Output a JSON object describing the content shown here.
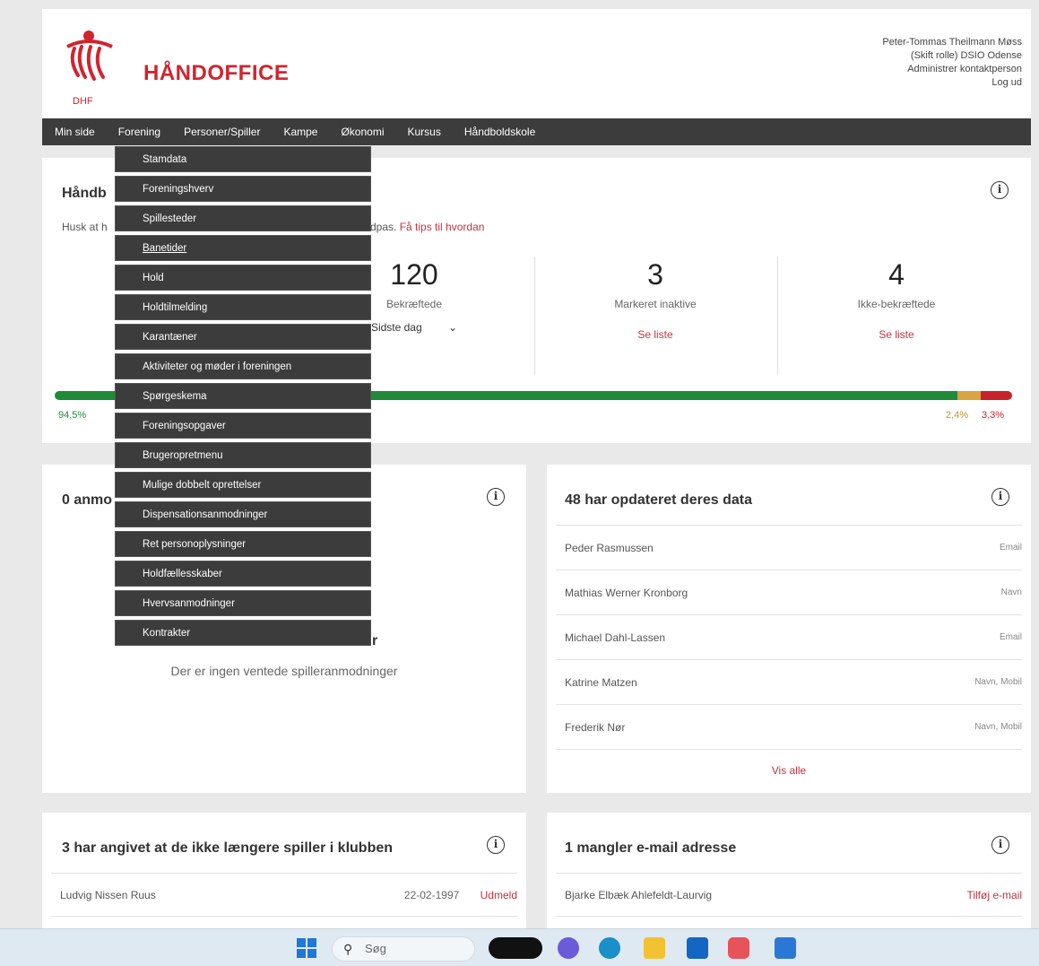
{
  "header": {
    "brand": "HÅNDOFFICE",
    "logo_text": "DHF",
    "user_name": "Peter-Tommas Theilmann Møss",
    "role_line": "(Skift rolle) DSIO Odense",
    "contact_link": "Administrer kontaktperson",
    "logout": "Log ud"
  },
  "nav": [
    "Min side",
    "Forening",
    "Personer/Spiller",
    "Kampe",
    "Økonomi",
    "Kursus",
    "Håndboldskole"
  ],
  "dropdown": {
    "items": [
      "Stamdata",
      "Foreningshverv",
      "Spillesteder",
      "Banetider",
      "Hold",
      "Holdtilmelding",
      "Karantæner",
      "Aktiviteter og møder i foreningen",
      "Spørgeskema",
      "Foreningsopgaver",
      "Brugeropretmenu",
      "Mulige dobbelt oprettelser",
      "Dispensationsanmodninger",
      "Ret personoplysninger",
      "Holdfællesskaber",
      "Hvervsanmodninger",
      "Kontrakter"
    ],
    "underlined_index": 3
  },
  "overview": {
    "title_partial": "Håndb",
    "hint_partial": "Husk at h",
    "hint_tail": "dpas.",
    "tips_link": "Få tips til hvordan",
    "stat1": {
      "value": "120",
      "label": "Bekræftede",
      "select": "Sidste dag"
    },
    "stat2": {
      "value": "3",
      "label": "Markeret inaktive",
      "link": "Se liste"
    },
    "stat3": {
      "value": "4",
      "label": "Ikke-bekræftede",
      "link": "Se liste"
    },
    "progress": {
      "green_pct": 94.5,
      "yellow_pct": 2.4,
      "red_pct": 3.3,
      "green_label": "94,5%",
      "yellow_label": "2,4%",
      "red_label": "3,3%",
      "colors": {
        "green": "#1f8a37",
        "yellow": "#d9a441",
        "red": "#c8232b"
      }
    }
  },
  "requests": {
    "title_partial": "0 anmo",
    "subtitle_partial": "r",
    "empty_text": "Der er ingen ventede spilleranmodninger"
  },
  "updated": {
    "title": "48 har opdateret deres data",
    "rows": [
      {
        "name": "Peder Rasmussen",
        "field": "Email"
      },
      {
        "name": "Mathias Werner Kronborg",
        "field": "Navn"
      },
      {
        "name": "Michael Dahl-Lassen",
        "field": "Email"
      },
      {
        "name": "Katrine Matzen",
        "field": "Navn, Mobil"
      },
      {
        "name": "Frederik Nør",
        "field": "Navn, Mobil"
      }
    ],
    "show_all": "Vis alle"
  },
  "left_club": {
    "title": "3 har angivet at de ikke længere spiller i klubben",
    "row": {
      "name": "Ludvig Nissen Ruus",
      "date": "22-02-1997",
      "action": "Udmeld"
    }
  },
  "missing_email": {
    "title": "1 mangler e-mail adresse",
    "row": {
      "name": "Bjarke Elbæk Ahlefeldt-Laurvig",
      "action": "Tilføj e-mail"
    }
  },
  "taskbar": {
    "search_placeholder": "Søg"
  }
}
